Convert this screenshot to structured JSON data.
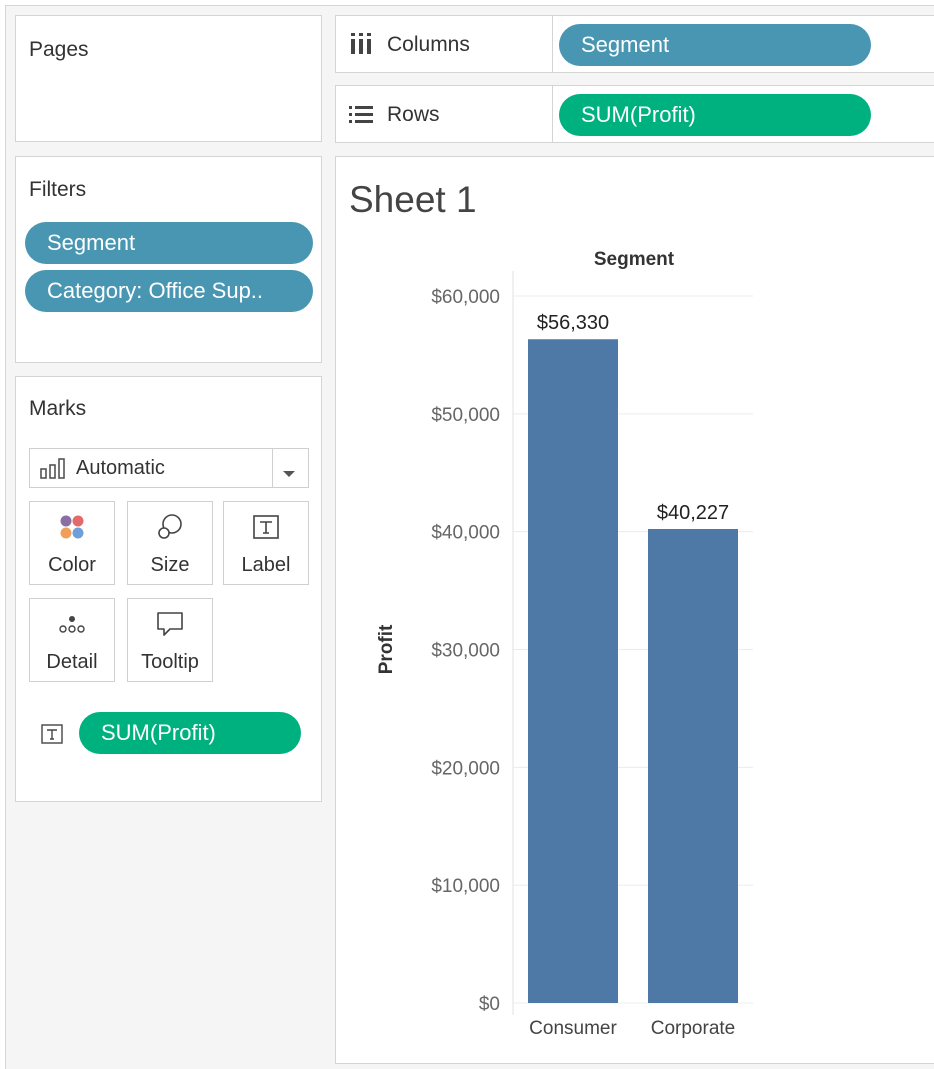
{
  "pages": {
    "title": "Pages"
  },
  "shelves": {
    "columns": {
      "label": "Columns",
      "pill": "Segment"
    },
    "rows": {
      "label": "Rows",
      "pill": "SUM(Profit)"
    }
  },
  "filters": {
    "title": "Filters",
    "items": [
      "Segment",
      "Category: Office Sup.."
    ]
  },
  "marks": {
    "title": "Marks",
    "mark_type": "Automatic",
    "buttons": {
      "color": "Color",
      "size": "Size",
      "label": "Label",
      "detail": "Detail",
      "tooltip": "Tooltip"
    },
    "label_pill": "SUM(Profit)"
  },
  "colors": {
    "dimension_pill": "#4996b2",
    "measure_pill": "#00b180",
    "bar": "#4e79a7"
  },
  "sheet": {
    "title": "Sheet 1"
  },
  "chart_data": {
    "type": "bar",
    "title": "",
    "column_header": "Segment",
    "xlabel": "",
    "ylabel": "Profit",
    "categories": [
      "Consumer",
      "Corporate"
    ],
    "values": [
      56330,
      40227
    ],
    "data_labels": [
      "$56,330",
      "$40,227"
    ],
    "ylim": [
      0,
      60000
    ],
    "yticks": [
      0,
      10000,
      20000,
      30000,
      40000,
      50000,
      60000
    ],
    "ytick_labels": [
      "$0",
      "$10,000",
      "$20,000",
      "$30,000",
      "$40,000",
      "$50,000",
      "$60,000"
    ],
    "grid": true,
    "legend": "none"
  }
}
